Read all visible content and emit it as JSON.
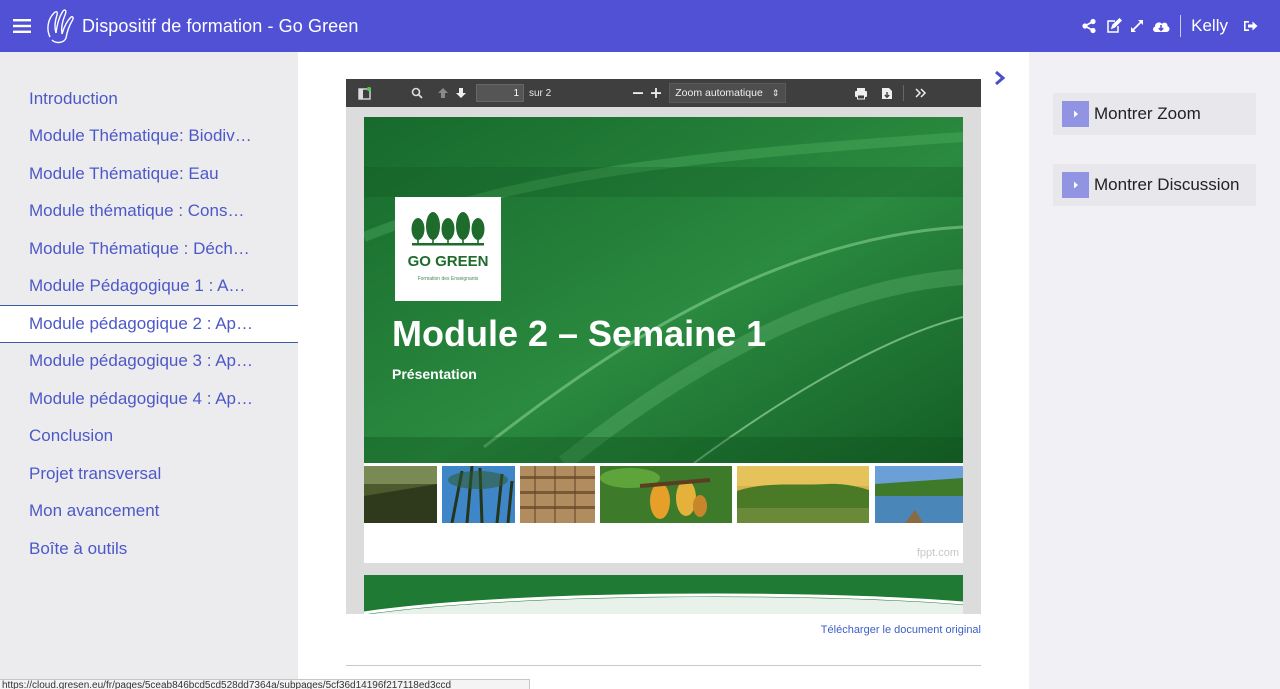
{
  "header": {
    "title": "Dispositif de formation - Go Green",
    "user": "Kelly",
    "icons": [
      "menu-icon",
      "app-logo-icon",
      "share-icon",
      "edit-icon",
      "expand-icon",
      "cloud-download-icon",
      "logout-icon"
    ]
  },
  "sidebar": {
    "items": [
      {
        "label": "Introduction"
      },
      {
        "label": "Module Thématique: Biodiv…"
      },
      {
        "label": "Module Thématique: Eau"
      },
      {
        "label": "Module thématique : Cons…"
      },
      {
        "label": "Module Thématique : Déch…"
      },
      {
        "label": "Module Pédagogique 1 : A…"
      },
      {
        "label": "Module pédagogique 2 : Ap…",
        "active": true
      },
      {
        "label": "Module pédagogique 3 : Ap…"
      },
      {
        "label": "Module pédagogique 4 : Ap…"
      },
      {
        "label": "Conclusion"
      },
      {
        "label": "Projet transversal"
      },
      {
        "label": "Mon avancement"
      },
      {
        "label": "Boîte à outils"
      }
    ]
  },
  "viewer": {
    "page_current": "1",
    "page_total_label": "sur 2",
    "zoom": "Zoom automatique",
    "slide": {
      "brand": "GO GREEN",
      "brand_sub": "Formation des Enseignants",
      "title": "Module 2 – Semaine 1",
      "subtitle": "Présentation",
      "watermark": "fppt.com"
    }
  },
  "download_link": "Télécharger le document original",
  "right_panel": {
    "zoom_button": "Montrer Zoom",
    "discussion_button": "Montrer Discussion"
  },
  "status_url": "https://cloud.gresen.eu/fr/pages/5ceab846bcd5cd528dd7364a/subpages/5cf36d14196f217118ed3ccd",
  "colors": {
    "header_bg": "#5151d6",
    "link": "#4d58c8",
    "accent_button": "#9193e3",
    "slide_green": "#1f6f33"
  }
}
